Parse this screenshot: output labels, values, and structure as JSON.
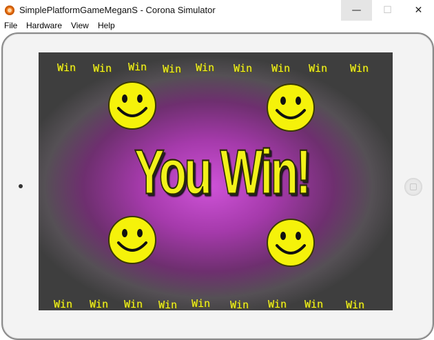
{
  "window": {
    "title": "SimplePlatformGameMeganS - Corona Simulator",
    "minimize_glyph": "—",
    "maximize_glyph": "☐",
    "close_glyph": "✕"
  },
  "menu": [
    "File",
    "Hardware",
    "View",
    "Help"
  ],
  "game": {
    "headline": "You Win!",
    "win_word": "Win",
    "smiley_color": "#f5f20a",
    "text_color": "#f7f728"
  }
}
